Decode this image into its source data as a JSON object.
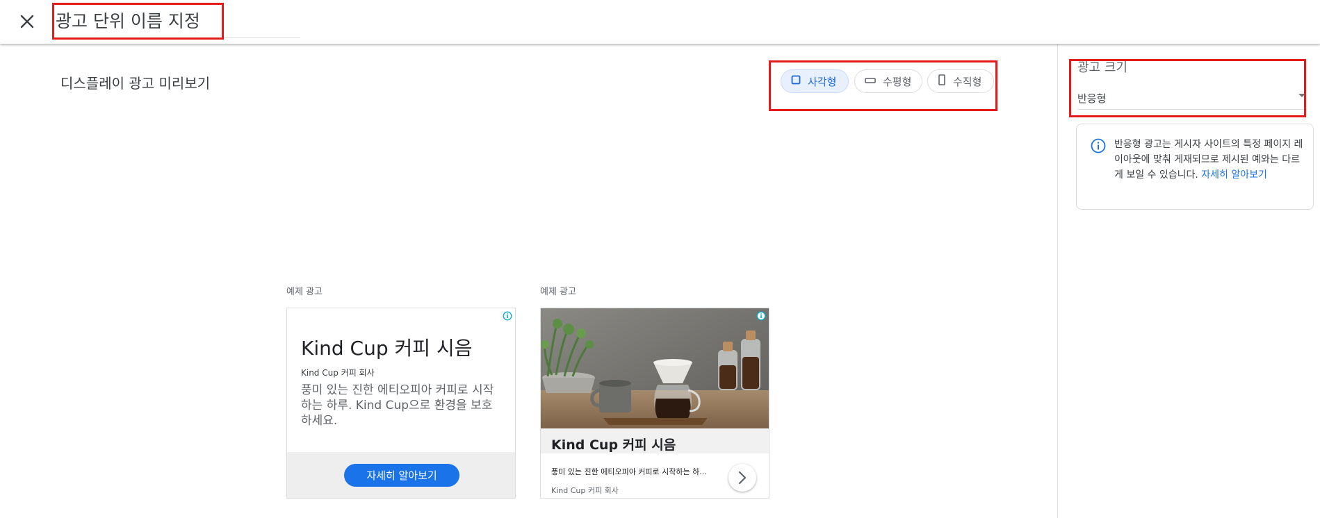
{
  "header": {
    "close_icon": "close-icon",
    "ad_unit_name_placeholder": "광고 단위 이름 지정"
  },
  "preview": {
    "title": "디스플레이 광고 미리보기",
    "shape_chips": [
      {
        "label": "사각형",
        "icon": "square-icon",
        "selected": true
      },
      {
        "label": "수평형",
        "icon": "horizontal-rectangle-icon",
        "selected": false
      },
      {
        "label": "수직형",
        "icon": "vertical-rectangle-icon",
        "selected": false
      }
    ]
  },
  "side_panel": {
    "ad_size_label": "광고 크기",
    "ad_size_value": "반응형",
    "info": {
      "icon": "info-icon",
      "text": "반응형 광고는 게시자 사이트의 특정 페이지 레이아웃에 맞춰 게재되므로 제시된 예와는 다르게 보일 수 있습니다. ",
      "link_text": "자세히 알아보기"
    }
  },
  "sample_ads": [
    {
      "label": "예제 광고",
      "title": "Kind Cup 커피 시음",
      "advertiser": "Kind Cup 커피 회사",
      "description": "풍미 있는 진한 에티오피아 커피로 시작하는 하루. Kind Cup으로 환경을 보호하세요.",
      "cta": "자세히 알아보기",
      "adchoices_icon": "adchoices-info-icon"
    },
    {
      "label": "예제 광고",
      "title": "Kind Cup 커피 시음",
      "description": "풍미 있는 진한 에티오피아 커피로 시작하는 하...",
      "advertiser": "Kind Cup 커피 회사",
      "image": "coffee-pour-over-photo",
      "arrow_icon": "chevron-right-icon",
      "adchoices_icon": "adchoices-info-icon"
    }
  ],
  "colors": {
    "accent": "#1a73e8",
    "chip_selected_bg": "#e8f0fe",
    "highlight": "#e41b1b"
  }
}
